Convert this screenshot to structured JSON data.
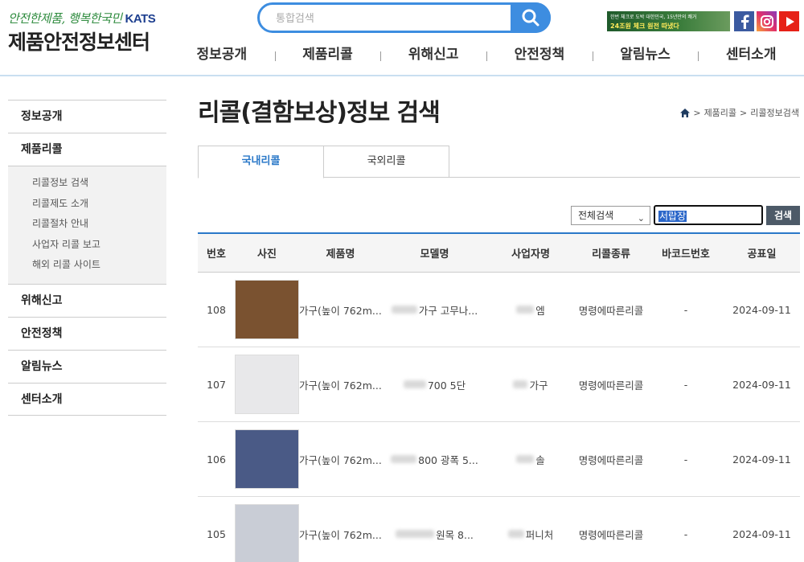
{
  "header": {
    "slogan": "안전한제품, 행복한국민",
    "katts": "KATS",
    "site_name": "제품안전정보센터",
    "search_placeholder": "통합검색",
    "banner_line1": "한번 체크로 도박 대한민국, 15년만의 쾌거",
    "banner_line2": "24조원 체크 원전 따냈다"
  },
  "gnb": [
    "정보공개",
    "제품리콜",
    "위해신고",
    "안전정책",
    "알림뉴스",
    "센터소개"
  ],
  "lnb": {
    "top": [
      "정보공개",
      "제품리콜",
      "위해신고",
      "안전정책",
      "알림뉴스",
      "센터소개"
    ],
    "sub": [
      "리콜정보 검색",
      "리콜제도 소개",
      "리콜절차 안내",
      "사업자 리콜 보고",
      "해외 리콜 사이트"
    ]
  },
  "page": {
    "title": "리콜(결함보상)정보 검색",
    "breadcrumb": [
      "제품리콜",
      "리콜정보검색"
    ],
    "tabs": [
      "국내리콜",
      "국외리콜"
    ]
  },
  "search": {
    "filter": "전체검색",
    "keyword": "서랍장",
    "button": "검색"
  },
  "table": {
    "headers": [
      "번호",
      "사진",
      "제품명",
      "모델명",
      "사업자명",
      "리콜종류",
      "바코드번호",
      "공표일"
    ],
    "rows": [
      {
        "no": "108",
        "product": "가구(높이 762m...",
        "model": "가구 고무나...",
        "company": "엠",
        "type": "명령에따른리콜",
        "barcode": "-",
        "date": "2024-09-11",
        "photo_color": "#7a5230"
      },
      {
        "no": "107",
        "product": "가구(높이 762m...",
        "model": "700 5단",
        "company": "가구",
        "type": "명령에따른리콜",
        "barcode": "-",
        "date": "2024-09-11",
        "photo_color": "#e8e8ea"
      },
      {
        "no": "106",
        "product": "가구(높이 762m...",
        "model": "800 광폭 5...",
        "company": "솔",
        "type": "명령에따른리콜",
        "barcode": "-",
        "date": "2024-09-11",
        "photo_color": "#4a5a86"
      },
      {
        "no": "105",
        "product": "가구(높이 762m...",
        "model": "원목 8...",
        "company": "퍼니처",
        "type": "명령에따른리콜",
        "barcode": "-",
        "date": "2024-09-11",
        "photo_color": "#c9cdd6"
      }
    ]
  }
}
